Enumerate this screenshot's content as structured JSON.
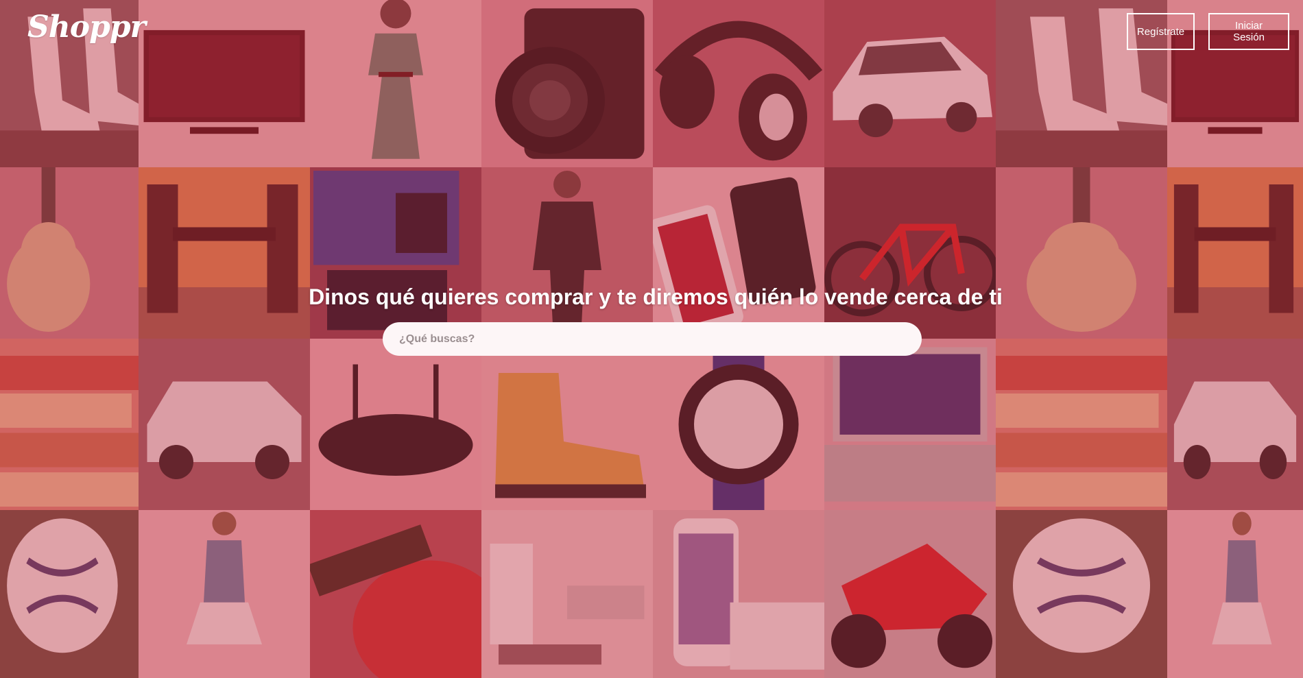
{
  "brand": {
    "logo": "Shoppr"
  },
  "header": {
    "register_label": "Regístrate",
    "login_label": "Iniciar Sesión"
  },
  "hero": {
    "headline": "Dinos qué quieres comprar y te diremos quién lo vende cerca de ti",
    "search_placeholder": "¿Qué buscas?"
  },
  "colors": {
    "overlay": "#c4364a",
    "button_border": "#ffffff",
    "search_bg": "#fdf6f7"
  },
  "background_products": [
    "high-heels",
    "television",
    "dress",
    "camera",
    "headphones",
    "car",
    "high-heels",
    "television",
    "guitar",
    "dining-table",
    "game-console",
    "man-suit",
    "smartphones",
    "bicycle",
    "guitar",
    "dining-table",
    "books",
    "suv",
    "router",
    "boot",
    "watch",
    "laptop",
    "books",
    "suv",
    "soccer-ball",
    "woman-skirt",
    "electric-guitar",
    "living-room",
    "iphone",
    "motorcycle",
    "soccer-ball",
    "woman-skirt"
  ]
}
